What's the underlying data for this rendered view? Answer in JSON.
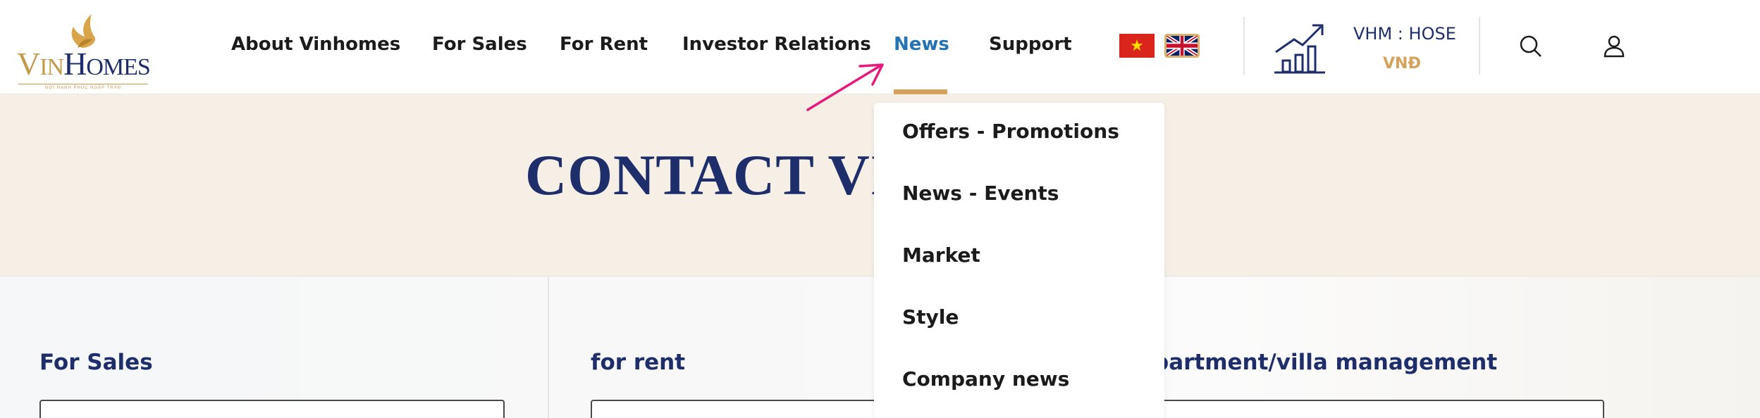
{
  "brand": {
    "logo_text_main": "V",
    "logo_text_rest": "IN",
    "logo_text_second_main": "H",
    "logo_text_second_rest": "OMES",
    "tagline": "NƠI HẠNH PHÚC NGẬP TRÀN",
    "gold": "#c49a4a",
    "navy": "#1e2e6b"
  },
  "nav": {
    "items": [
      {
        "label": "About Vinhomes"
      },
      {
        "label": "For Sales"
      },
      {
        "label": "For Rent"
      },
      {
        "label": "Investor Relations"
      },
      {
        "label": "News"
      },
      {
        "label": "Support"
      }
    ],
    "active_color": "#2474b5",
    "underline_color": "#d4a25a"
  },
  "languages": {
    "vn_icon": "flag-vn-icon",
    "vn_star": "★",
    "uk_icon": "flag-uk-icon"
  },
  "stock": {
    "icon": "chart-up-icon",
    "code": "VHM : HOSE",
    "currency": "VNĐ"
  },
  "header_icons": {
    "search": "search-icon",
    "account": "user-icon"
  },
  "banner": {
    "title": "CONTACT VI"
  },
  "forms": {
    "headings": [
      "For Sales",
      "for rent",
      "partment/villa management"
    ]
  },
  "dropdown": {
    "items": [
      {
        "label": "Offers - Promotions"
      },
      {
        "label": "News - Events"
      },
      {
        "label": "Market"
      },
      {
        "label": "Style"
      },
      {
        "label": "Company news"
      }
    ]
  },
  "annotation": {
    "arrow_icon": "pointer-arrow-icon",
    "arrow_color": "#e8197d"
  }
}
